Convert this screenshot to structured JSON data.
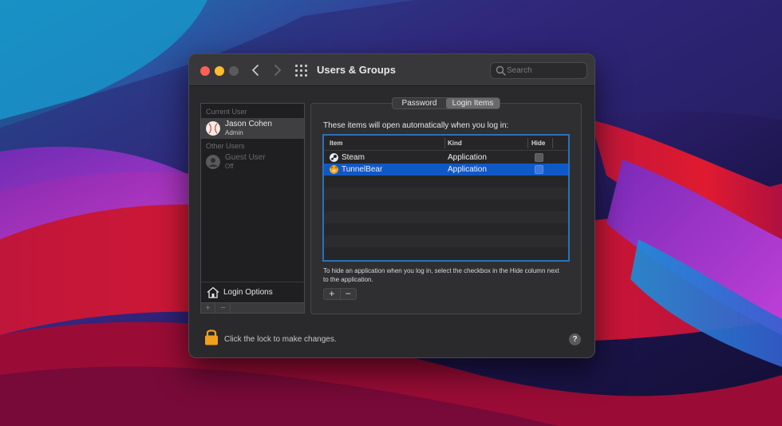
{
  "window": {
    "title": "Users & Groups",
    "search": {
      "placeholder": "Search",
      "value": ""
    }
  },
  "sidebar": {
    "current_user_label": "Current User",
    "current_user": {
      "name": "Jason Cohen",
      "role": "Admin"
    },
    "other_users_label": "Other Users",
    "other_users": [
      {
        "name": "Guest User",
        "role": "Off"
      }
    ],
    "login_options_label": "Login Options",
    "add_label": "+",
    "remove_label": "−"
  },
  "tabs": [
    {
      "label": "Password",
      "active": false
    },
    {
      "label": "Login Items",
      "active": true
    }
  ],
  "login_items": {
    "intro": "These items will open automatically when you log in:",
    "columns": {
      "item": "Item",
      "kind": "Kind",
      "hide": "Hide"
    },
    "rows": [
      {
        "name": "Steam",
        "kind": "Application",
        "hide": false,
        "selected": false
      },
      {
        "name": "TunnelBear",
        "kind": "Application",
        "hide": false,
        "selected": true
      }
    ],
    "help_text": "To hide an application when you log in, select the checkbox in the Hide column next to the application.",
    "add_label": "+",
    "remove_label": "−"
  },
  "footer": {
    "lock_text": "Click the lock to make changes.",
    "help_label": "?"
  },
  "colors": {
    "selection": "#1158c7",
    "table_focus": "#2a72b8",
    "close": "#ff5f57",
    "minimize": "#febc2e",
    "lock": "#f0a020"
  }
}
